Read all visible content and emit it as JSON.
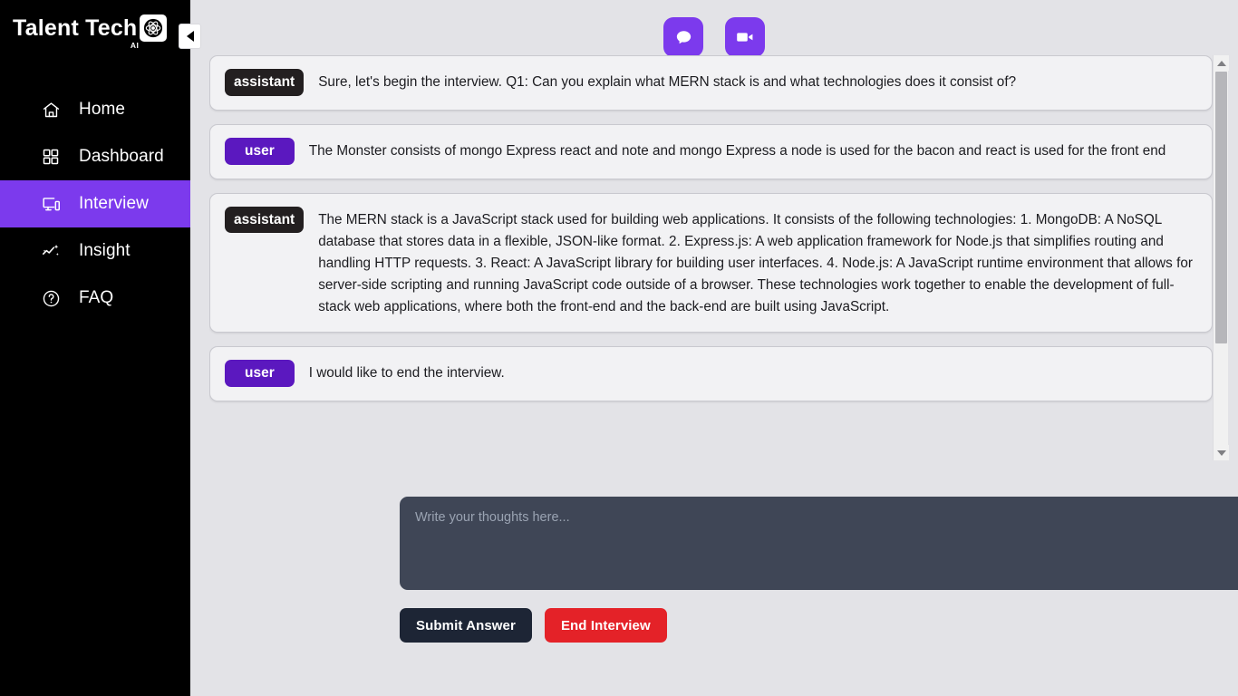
{
  "brand": {
    "name": "Talent Tech",
    "suffix": "AI",
    "mark_icon": "atom-icon"
  },
  "sidebar": {
    "collapse_label": "collapse-sidebar",
    "items": [
      {
        "label": "Home",
        "icon": "home-icon",
        "active": false
      },
      {
        "label": "Dashboard",
        "icon": "grid-icon",
        "active": false
      },
      {
        "label": "Interview",
        "icon": "devices-icon",
        "active": true
      },
      {
        "label": "Insight",
        "icon": "trend-sparkle-icon",
        "active": false
      },
      {
        "label": "FAQ",
        "icon": "question-circle-icon",
        "active": false
      }
    ],
    "active_color": "#7c3aed",
    "background": "#000000"
  },
  "topbar": {
    "chat_mode_icon": "chat-bubble-icon",
    "video_mode_icon": "video-camera-icon",
    "button_color": "#7c3aed"
  },
  "chat": {
    "messages": [
      {
        "role": "assistant",
        "text": "Sure, let's begin the interview. Q1: Can you explain what MERN stack is and what technologies does it consist of?"
      },
      {
        "role": "user",
        "text": "The Monster consists of mongo Express react and note and mongo Express a node is used for the bacon and react is used for the front end"
      },
      {
        "role": "assistant",
        "text": "The MERN stack is a JavaScript stack used for building web applications. It consists of the following technologies: 1. MongoDB: A NoSQL database that stores data in a flexible, JSON-like format. 2. Express.js: A web application framework for Node.js that simplifies routing and handling HTTP requests. 3. React: A JavaScript library for building user interfaces. 4. Node.js: A JavaScript runtime environment that allows for server-side scripting and running JavaScript code outside of a browser. These technologies work together to enable the development of full-stack web applications, where both the front-end and the back-end are built using JavaScript."
      },
      {
        "role": "user",
        "text": "I would like to end the interview."
      }
    ],
    "assistant_badge_color": "#231f20",
    "user_badge_color": "#5b18bf"
  },
  "composer": {
    "answer_placeholder": "Write your thoughts here...",
    "answer_value": "",
    "submit_label": "Submit Answer",
    "end_label": "End Interview",
    "submit_color": "#1d2535",
    "end_color": "#e42228"
  }
}
